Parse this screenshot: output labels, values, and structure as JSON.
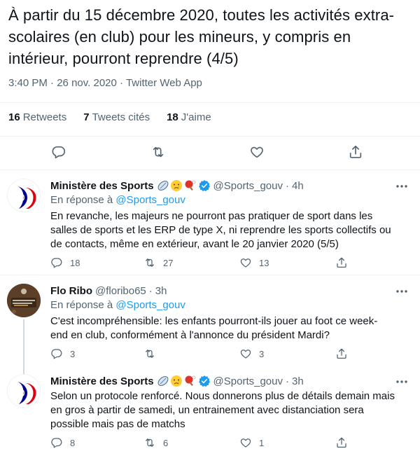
{
  "main_tweet": {
    "text_line1": "À partir du 15 décembre 2020, toutes les activités extra-",
    "text_line2": "scolaires (en club) pour les mineurs, y compris en",
    "text_line3": "intérieur, pourront reprendre (4/5)",
    "time": "3:40 PM",
    "date": "26 nov. 2020",
    "source": "Twitter Web App",
    "separator": "·",
    "retweets_count": "16",
    "retweets_label": "Retweets",
    "quotes_count": "7",
    "quotes_label": "Tweets cités",
    "likes_count": "18",
    "likes_label": "J'aime"
  },
  "replies": [
    {
      "name": "Ministère des Sports",
      "handle": "@Sports_gouv",
      "age": "4h",
      "in_reply_prefix": "En réponse à",
      "in_reply_handle": "@Sports_gouv",
      "text_line1": "En revanche, les majeurs ne pourront pas pratiquer de sport dans les",
      "text_line2": "salles de sports et les ERP de type X, ni reprendre les sports collectifs ou",
      "text_line3": "de contacts, même en extérieur, avant le 20 janvier 2020 (5/5)",
      "replies": "18",
      "retweets": "27",
      "likes": "13"
    },
    {
      "name": "Flo Ribo",
      "handle": "@floribo65",
      "age": "3h",
      "in_reply_prefix": "En réponse à",
      "in_reply_handle": "@Sports_gouv",
      "text_line1": "C'est incompréhensible: les enfants pourront-ils jouer au foot ce week-",
      "text_line2": "end en club, conformément à l'annonce du président Mardi?",
      "replies": "3",
      "retweets": "",
      "likes": "3"
    },
    {
      "name": "Ministère des Sports",
      "handle": "@Sports_gouv",
      "age": "3h",
      "text_line1": "Selon un protocole renforcé. Nous donnerons plus de détails demain mais",
      "text_line2": "en gros à partir de samedi, un entrainement avec distanciation sera",
      "text_line3": "possible mais pas de matchs",
      "replies": "8",
      "retweets": "6",
      "likes": "1"
    }
  ],
  "icons": {
    "reply": "reply-icon",
    "retweet": "retweet-icon",
    "like": "like-icon",
    "share": "share-icon",
    "verified": "verified-badge-icon",
    "more": "more-icon"
  },
  "colors": {
    "accent": "#1d9bf0",
    "text": "#0f1419",
    "secondary": "#536471",
    "divider": "#eff3f4"
  }
}
